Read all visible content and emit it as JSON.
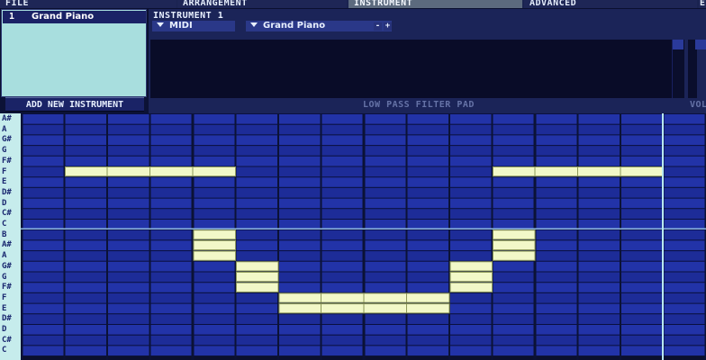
{
  "menu": {
    "tabs": [
      {
        "label": "FILE",
        "active": false
      },
      {
        "label": "ARRANGEMENT",
        "active": false
      },
      {
        "label": "INSTRUMENT",
        "active": true
      },
      {
        "label": "ADVANCED",
        "active": false
      },
      {
        "label": "E",
        "active": false
      }
    ]
  },
  "instrument_list": {
    "items": [
      {
        "number": "1",
        "name": "Grand Piano",
        "selected": true
      }
    ],
    "add_button_label": "ADD NEW INSTRUMENT"
  },
  "instrument_panel": {
    "title": "INSTRUMENT 1",
    "input_type": "MIDI",
    "preset": "Grand Piano",
    "minus_label": "-",
    "plus_label": "+",
    "pad_label": "LOW PASS FILTER PAD",
    "vol_label": "VOL"
  },
  "piano_roll": {
    "note_labels": [
      "A#",
      "A",
      "G#",
      "G",
      "F#",
      "F",
      "E",
      "D#",
      "D",
      "C#",
      "C",
      "B",
      "A#",
      "A",
      "G#",
      "G",
      "F#",
      "F",
      "E",
      "D#",
      "D",
      "C#",
      "C"
    ],
    "columns": 16,
    "notes": [
      {
        "row": 5,
        "start": 1,
        "end": 5
      },
      {
        "row": 5,
        "start": 11,
        "end": 15
      },
      {
        "row": 11,
        "start": 4,
        "end": 5
      },
      {
        "row": 12,
        "start": 4,
        "end": 5
      },
      {
        "row": 13,
        "start": 4,
        "end": 5
      },
      {
        "row": 11,
        "start": 11,
        "end": 12
      },
      {
        "row": 12,
        "start": 11,
        "end": 12
      },
      {
        "row": 13,
        "start": 11,
        "end": 12
      },
      {
        "row": 14,
        "start": 5,
        "end": 6
      },
      {
        "row": 15,
        "start": 5,
        "end": 6
      },
      {
        "row": 16,
        "start": 5,
        "end": 6
      },
      {
        "row": 14,
        "start": 10,
        "end": 11
      },
      {
        "row": 15,
        "start": 10,
        "end": 11
      },
      {
        "row": 16,
        "start": 10,
        "end": 11
      },
      {
        "row": 17,
        "start": 6,
        "end": 10
      },
      {
        "row": 18,
        "start": 6,
        "end": 10
      }
    ],
    "colors": {
      "row_a": "#2233a8",
      "row_b": "#1d2c98",
      "row_line": "#0a1040",
      "col_line": "#0b1236",
      "note_fill": "#f2f8c8",
      "note_edge": "#8f9a5a",
      "playhead": "#b8e8f0",
      "octave_line": "#8fb8e0"
    }
  }
}
